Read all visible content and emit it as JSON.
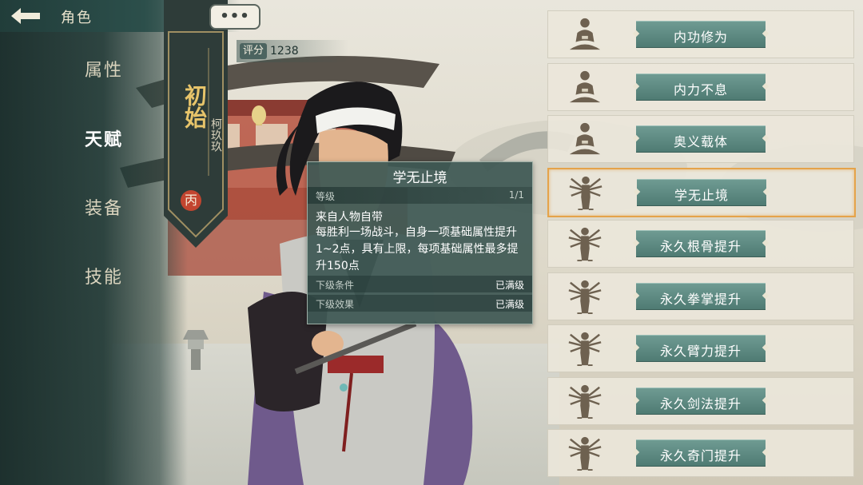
{
  "header": {
    "title": "角色",
    "back_icon": "back-arrow-icon",
    "more_icon": "ellipsis-icon"
  },
  "nav": {
    "items": [
      {
        "label": "属性",
        "active": false
      },
      {
        "label": "天赋",
        "active": true
      },
      {
        "label": "装备",
        "active": false
      },
      {
        "label": "技能",
        "active": false
      }
    ]
  },
  "character": {
    "rank": "初始",
    "name": "柯玖玖",
    "badge": "丙",
    "score_label": "评分",
    "score": "1238"
  },
  "tooltip": {
    "title": "学无止境",
    "level_label": "等级",
    "level_value": "1/1",
    "source": "来自人物自带",
    "description": "每胜利一场战斗，自身一项基础属性提升1~2点，具有上限，每项基础属性最多提升150点",
    "next_condition_label": "下级条件",
    "next_condition_value": "已满级",
    "next_effect_label": "下级效果",
    "next_effect_value": "已满级"
  },
  "skills": [
    {
      "label": "内功修为",
      "icon": "meditating-monk-icon",
      "selected": false
    },
    {
      "label": "内力不息",
      "icon": "meditating-monk-icon",
      "selected": false
    },
    {
      "label": "奥义载体",
      "icon": "meditating-monk-icon",
      "selected": false
    },
    {
      "label": "学无止境",
      "icon": "multi-armed-figure-icon",
      "selected": true
    },
    {
      "label": "永久根骨提升",
      "icon": "multi-armed-figure-icon",
      "selected": false
    },
    {
      "label": "永久拳掌提升",
      "icon": "multi-armed-figure-icon",
      "selected": false
    },
    {
      "label": "永久臂力提升",
      "icon": "multi-armed-figure-icon",
      "selected": false
    },
    {
      "label": "永久剑法提升",
      "icon": "multi-armed-figure-icon",
      "selected": false
    },
    {
      "label": "永久奇门提升",
      "icon": "multi-armed-figure-icon",
      "selected": false
    }
  ],
  "colors": {
    "accent": "#e5a34a",
    "panel": "#2c4f4b",
    "button": "#5f8b83",
    "badge": "#c2452f"
  }
}
